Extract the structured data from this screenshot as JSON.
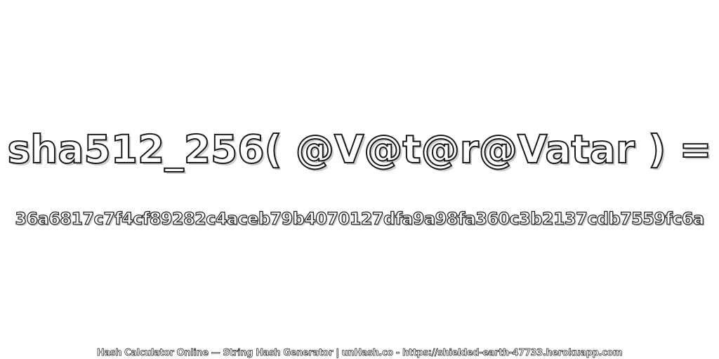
{
  "title": "sha512_256( @V@t@r@Vatar ) =",
  "hash": "36a6817c7f4cf89282c4aceb79b4070127dfa9a98fa360c3b2137cdb7559fc6a",
  "footer": "Hash Calculator Online — String Hash Generator | unHash.co - https://shielded-earth-47733.herokuapp.com"
}
